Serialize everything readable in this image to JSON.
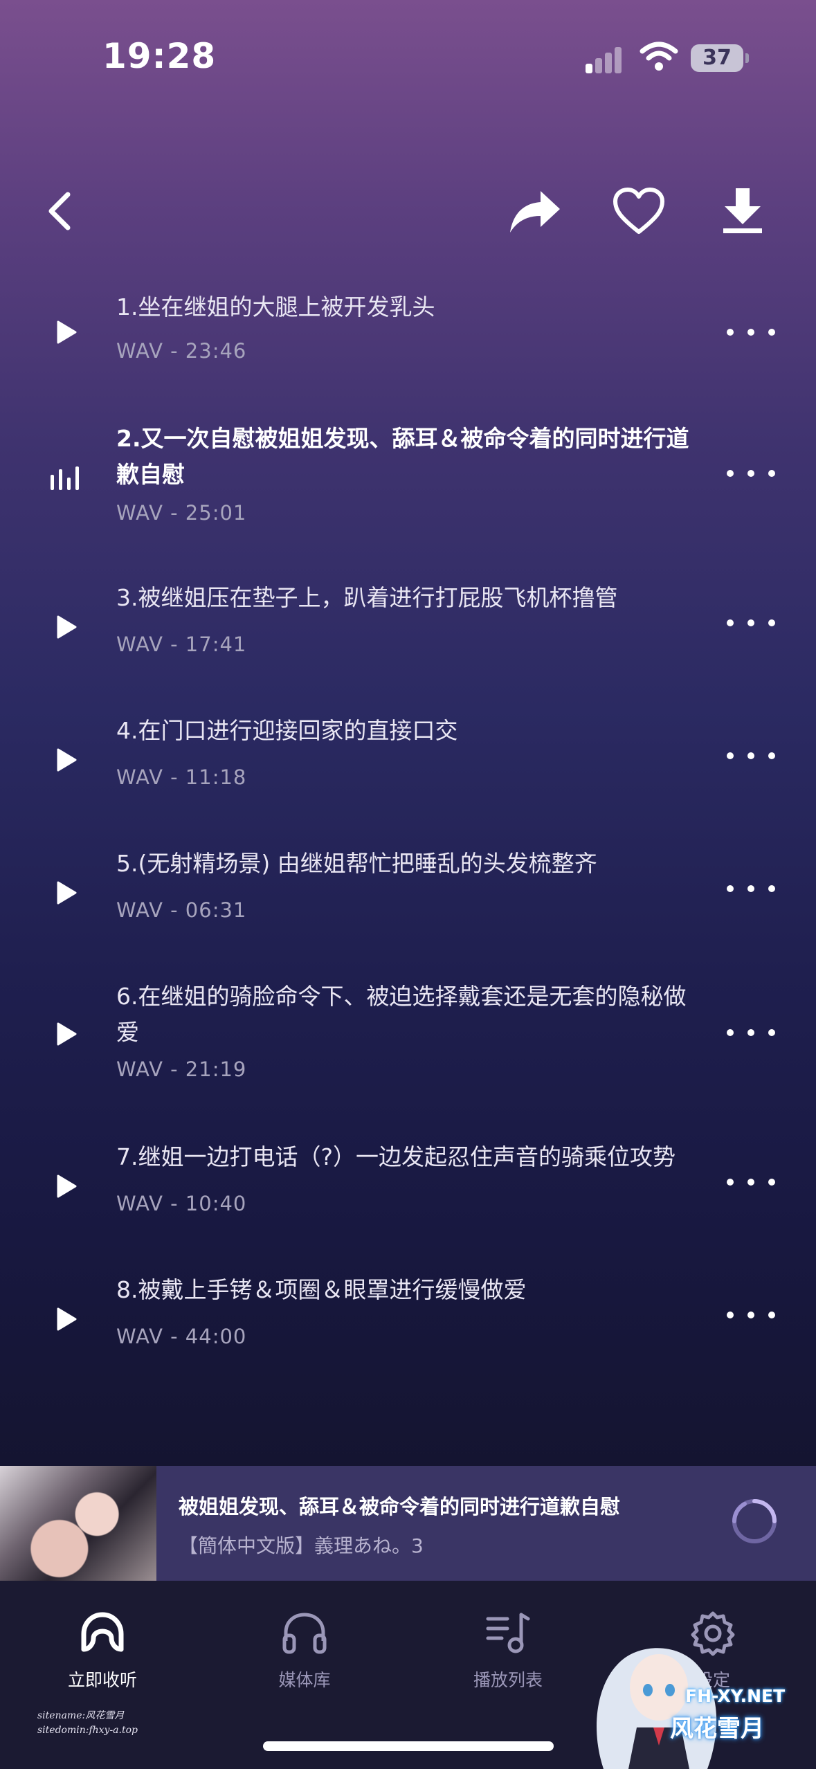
{
  "status": {
    "time": "19:28",
    "battery": "37"
  },
  "tracks": [
    {
      "title": "1.坐在继姐的大腿上被开发乳头",
      "meta": "WAV - 23:46"
    },
    {
      "title": "2.又一次自慰被姐姐发现、舔耳＆被命令着的同时进行道歉自慰",
      "meta": "WAV - 25:01"
    },
    {
      "title": "3.被继姐压在垫子上，趴着进行打屁股飞机杯撸管",
      "meta": "WAV - 17:41"
    },
    {
      "title": "4.在门口进行迎接回家的直接口交",
      "meta": "WAV - 11:18"
    },
    {
      "title": "5.(无射精场景) 由继姐帮忙把睡乱的头发梳整齐",
      "meta": "WAV - 06:31"
    },
    {
      "title": "6.在继姐的骑脸命令下、被迫选择戴套还是无套的隐秘做爱",
      "meta": "WAV - 21:19"
    },
    {
      "title": "7.继姐一边打电话（?）一边发起忍住声音的骑乘位攻势",
      "meta": "WAV - 10:40"
    },
    {
      "title": "8.被戴上手铐＆项圈＆眼罩进行缓慢做爱",
      "meta": "WAV - 44:00"
    }
  ],
  "now_playing": {
    "title": "被姐姐发现、舔耳＆被命令着的同时进行道歉自慰",
    "subtitle": "【簡体中文版】義理あね。3"
  },
  "tabs": [
    {
      "label": "立即收听"
    },
    {
      "label": "媒体库"
    },
    {
      "label": "播放列表"
    },
    {
      "label": "设定"
    }
  ],
  "watermark": {
    "line1": "sitename:风花雪月",
    "line2": "sitedomin:fhxy-a.top",
    "site_url": "FH-XY.NET",
    "site_name": "风花雪月"
  }
}
